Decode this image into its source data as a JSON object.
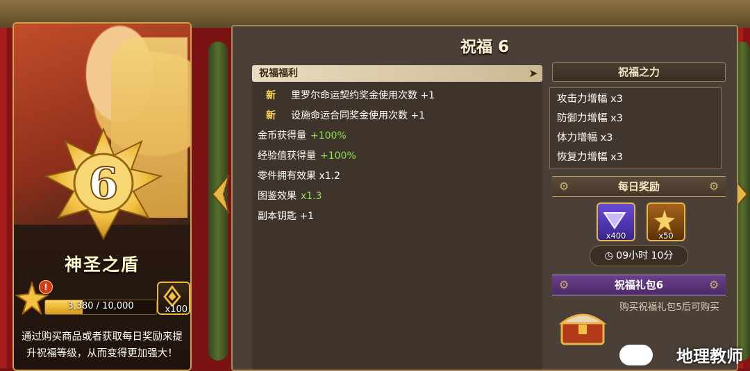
{
  "hero": {
    "level": "6",
    "name": "神圣之盾",
    "exp_text": "3,380 / 10,000",
    "exp_fraction": 0.338,
    "alert_badge": "!",
    "item_count": "x100",
    "description": "通过购买商品或者获取每日奖励来提升祝福等级，从而变得更加强大！"
  },
  "title": "祝福 6",
  "benefits": {
    "header": "祝福福利",
    "items": [
      {
        "tag": "新",
        "text": "里罗尔命运契约奖金使用次数 +1",
        "highlight": ""
      },
      {
        "tag": "新",
        "text": "设施命运合同奖金使用次数 +1",
        "highlight": ""
      },
      {
        "tag": "",
        "text": "金币获得量",
        "highlight": "+100%"
      },
      {
        "tag": "",
        "text": "经验值获得量",
        "highlight": "+100%"
      },
      {
        "tag": "",
        "text": "零件拥有效果 x1.2",
        "highlight": ""
      },
      {
        "tag": "",
        "text": "图鉴效果",
        "highlight": "x1.3"
      },
      {
        "tag": "",
        "text": "副本钥匙 +1",
        "highlight": ""
      }
    ]
  },
  "power": {
    "header": "祝福之力",
    "items": [
      "攻击力增幅 x3",
      "防御力增幅 x3",
      "体力增幅 x3",
      "恢复力增幅 x3"
    ]
  },
  "daily": {
    "header": "每日奖励",
    "rewards": [
      {
        "icon": "purple-gem-icon",
        "count": "x400"
      },
      {
        "icon": "gold-star-icon",
        "count": "x50"
      }
    ],
    "timer": "09小时 10分"
  },
  "pack": {
    "header": "祝福礼包6",
    "text": "购买祝福礼包5后可购买"
  },
  "watermark": "地理教师",
  "colors": {
    "highlight": "#8fe04a",
    "gold": "#e3b84b",
    "pack_purple": "#5a3378"
  }
}
